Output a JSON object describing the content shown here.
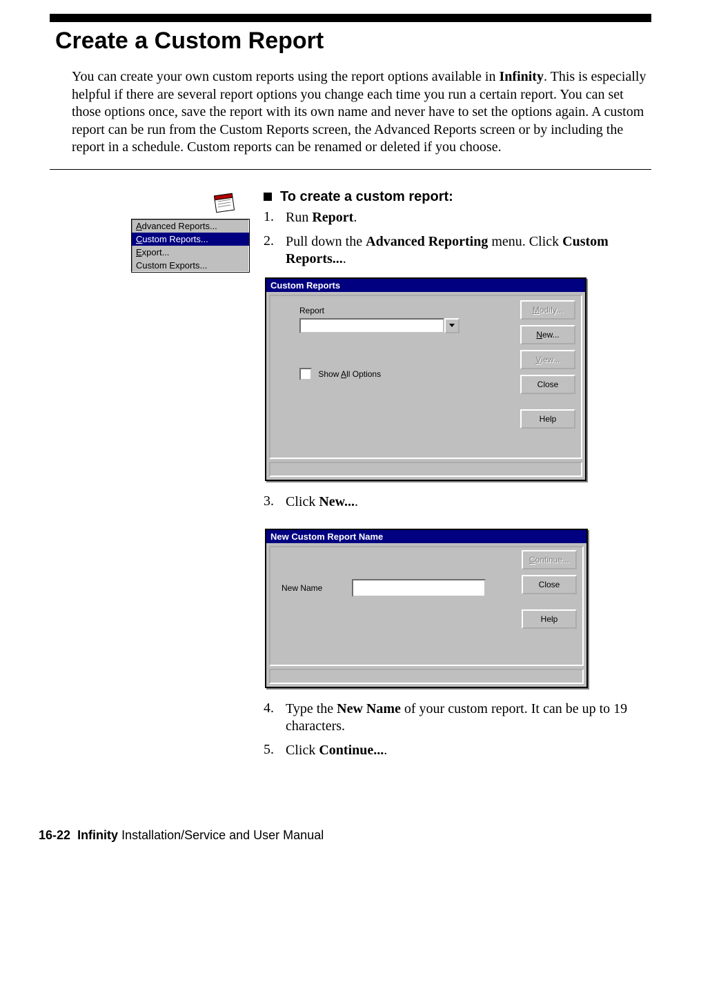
{
  "page": {
    "title": "Create a Custom Report",
    "intro_html": "You can create your own custom reports using the report options available in <b>Infinity</b>. This is especially helpful if there are several report options you change each time you run a certain report. You can set those options once, save the report with its own name and never have to set the options again. A custom report can be run from the Custom Reports screen, the Advanced Reports screen or by including the report in a schedule. Custom reports can be renamed or deleted if you choose.",
    "task_heading": "To create a custom report:",
    "steps": {
      "s1": {
        "num": "1.",
        "html": "Run <b>Report</b>."
      },
      "s2": {
        "num": "2.",
        "html": "Pull down the <b>Advanced Reporting</b> menu. Click <b>Custom Reports...</b>."
      },
      "s3": {
        "num": "3.",
        "html": "Click <b>New...</b>."
      },
      "s4": {
        "num": "4.",
        "html": "Type the <b>New Name</b> of your custom report. It can be up to 19 characters."
      },
      "s5": {
        "num": "5.",
        "html": "Click <b>Continue...</b>."
      }
    }
  },
  "menu_popup": {
    "items": [
      {
        "html": "<span class='u'>A</span>dvanced Reports...",
        "selected": false
      },
      {
        "html": "<span class='u'>C</span>ustom Reports...",
        "selected": true
      },
      {
        "html": "<span class='u'>E</span>xport...",
        "selected": false
      },
      {
        "html": "Custom Exports...",
        "selected": false
      }
    ]
  },
  "dlg_custom_reports": {
    "title": "Custom Reports",
    "field_report": "Report",
    "checkbox_html": "Show <span class='u'>A</span>ll Options",
    "buttons": {
      "modify_html": "<span class='u'>M</span>odify...",
      "new_html": "<span class='u'>N</span>ew...",
      "view_html": "<span class='u'>V</span>iew...",
      "close": "Close",
      "help": "Help"
    }
  },
  "dlg_new_name": {
    "title": "New Custom Report Name",
    "field_label": "New Name",
    "buttons": {
      "continue_html": "<span class='u'>C</span>ontinue...",
      "close": "Close",
      "help": "Help"
    }
  },
  "footer": {
    "page_num": "16-22",
    "product": "Infinity",
    "text": " Installation/Service and User Manual"
  }
}
